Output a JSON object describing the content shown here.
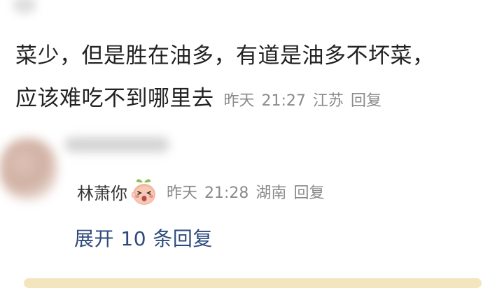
{
  "comment": {
    "line1": "菜少，但是胜在油多，有道是油多不坏菜，",
    "line2": "应该难吃不到哪里去",
    "time_day": "昨天",
    "time": "21:27",
    "location": "江苏",
    "reply_label": "回复"
  },
  "reply": {
    "username": "林萧你",
    "emoji": "peach-face-emoji",
    "time_day": "昨天",
    "time": "21:28",
    "location": "湖南",
    "reply_label": "回复"
  },
  "expand": {
    "label": "展开 10 条回复"
  },
  "colors": {
    "text": "#222222",
    "meta": "#8a8a8a",
    "link": "#2e4a7c",
    "bottom_bar": "#f3e6bf"
  }
}
